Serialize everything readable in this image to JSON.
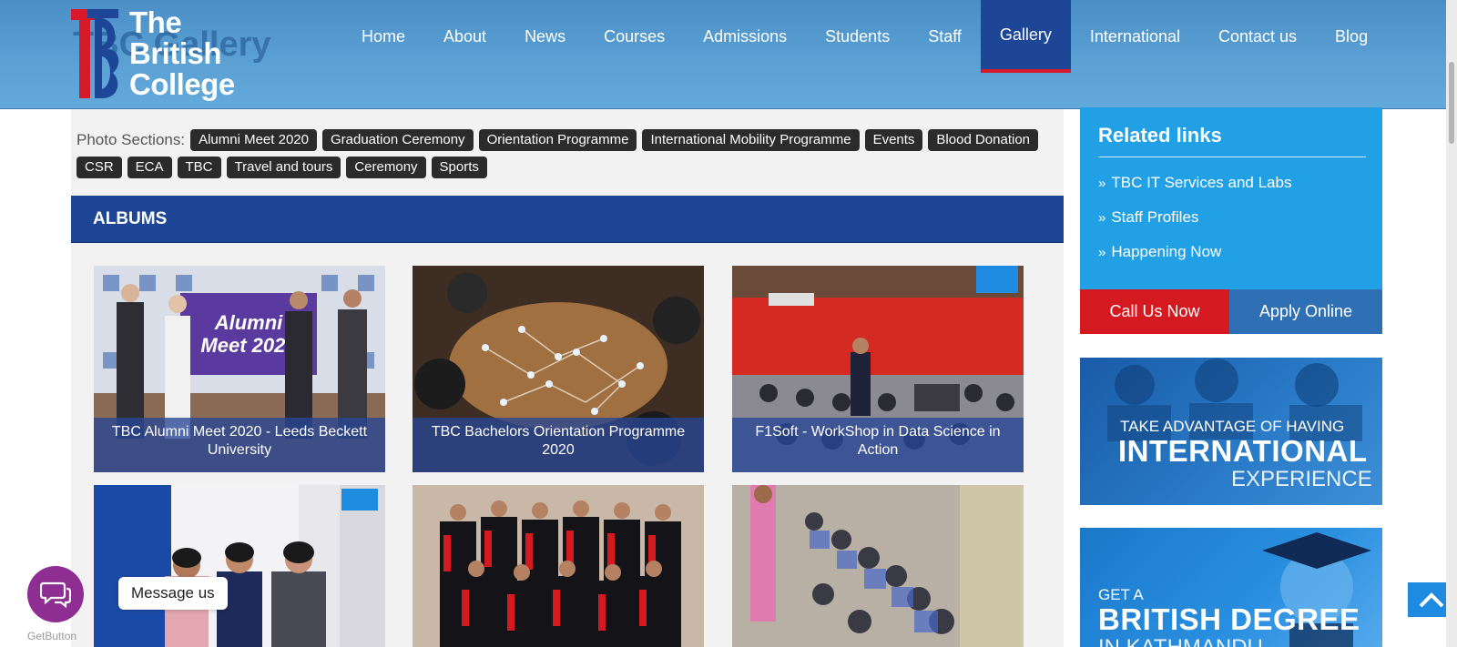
{
  "header": {
    "ghost_title": "TBC Gallery",
    "logo": {
      "line1": "The",
      "line2": "British",
      "line3": "College"
    },
    "nav": [
      {
        "label": "Home",
        "active": false
      },
      {
        "label": "About",
        "active": false
      },
      {
        "label": "News",
        "active": false
      },
      {
        "label": "Courses",
        "active": false
      },
      {
        "label": "Admissions",
        "active": false
      },
      {
        "label": "Students",
        "active": false
      },
      {
        "label": "Staff",
        "active": false
      },
      {
        "label": "Gallery",
        "active": true
      },
      {
        "label": "International",
        "active": false
      },
      {
        "label": "Contact us",
        "active": false
      },
      {
        "label": "Blog",
        "active": false
      }
    ]
  },
  "photo_sections": {
    "label": "Photo Sections:",
    "chips": [
      "Alumni Meet 2020",
      "Graduation Ceremony",
      "Orientation Programme",
      "International Mobility Programme",
      "Events",
      "Blood Donation",
      "CSR",
      "ECA",
      "TBC",
      "Travel and tours",
      "Ceremony",
      "Sports"
    ]
  },
  "albums": {
    "heading": "ALBUMS",
    "cards": [
      {
        "caption": "TBC Alumni Meet 2020 - Leeds Beckett University",
        "overlay": "Alumni Meet 2020"
      },
      {
        "caption": "TBC Bachelors Orientation Programme 2020"
      },
      {
        "caption": "F1Soft - WorkShop in Data Science in Action"
      },
      {
        "caption": ""
      },
      {
        "caption": ""
      },
      {
        "caption": ""
      }
    ]
  },
  "sidebar": {
    "related_title": "Related links",
    "links": [
      "TBC IT Services and Labs",
      "Staff Profiles",
      "Happening Now"
    ],
    "call_label": "Call Us Now",
    "apply_label": "Apply Online",
    "banner1": {
      "line1": "TAKE ADVANTAGE OF HAVING",
      "line2": "INTERNATIONAL",
      "line3": "EXPERIENCE"
    },
    "banner2": {
      "line1": "GET A",
      "line2": "BRITISH DEGREE",
      "line3": "IN KATHMANDU"
    }
  },
  "floaters": {
    "message_label": "Message us",
    "getbutton": "GetButton"
  },
  "colors": {
    "header_blue": "#5aa0d3",
    "nav_active": "#1e4696",
    "accent_red": "#d7192a",
    "sidebar_blue": "#22a0e6",
    "chip_dark": "#2b2b2b"
  }
}
